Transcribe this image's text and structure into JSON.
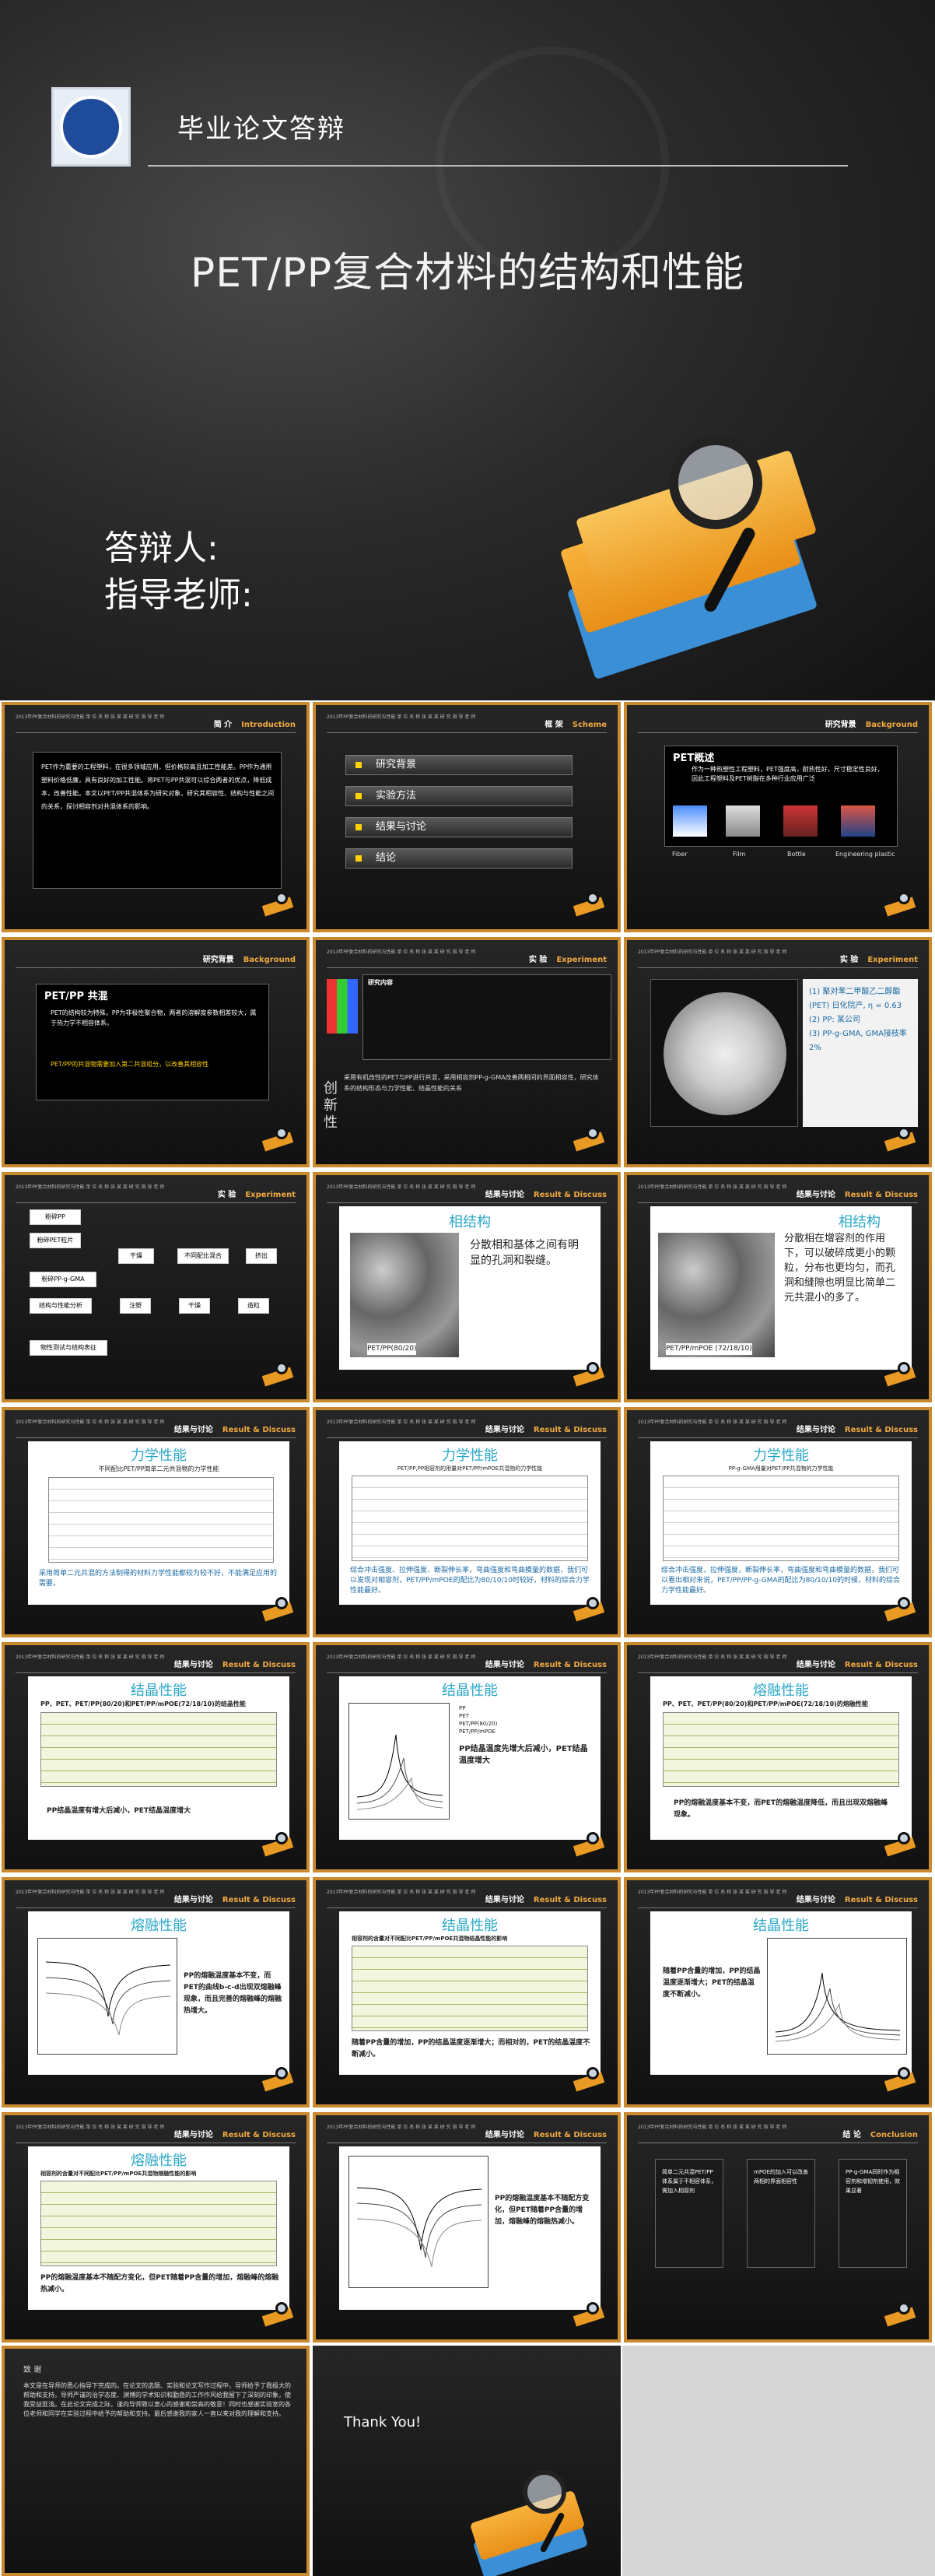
{
  "title_slide": {
    "school": "毕业论文答辩",
    "title": "PET/PP复合材料的结构和性能",
    "defender": "答辩人:",
    "advisor": "指导老师:"
  },
  "slide_header_tiny": "2013年PP复合材料的研究与性能\n单 位 名 称 张 某 某\n研 究 指 导 老 师",
  "slides": [
    {
      "cn": "简 介",
      "en": "Introduction",
      "body": "PET作为重要的工程塑料，在很多领域应用，但价格较高且加工性能差。PP作为通用塑料价格低廉，具有良好的加工性能。将PET与PP共混可以综合两者的优点，降低成本，改善性能。本文以PET/PP共混体系为研究对象，研究其相容性、结构与性能之间的关系，探讨相容剂对共混体系的影响。"
    },
    {
      "cn": "框 架",
      "en": "Scheme",
      "items": [
        "研究背景",
        "实验方法",
        "结果与讨论",
        "结论"
      ]
    },
    {
      "cn": "研究背景",
      "en": "Background",
      "head": "PET概述",
      "body": "作为一种热塑性工程塑料，PET强度高，耐热性好，尺寸稳定性良好，因此工程塑料及PET树脂在多种行业应用广泛",
      "labels": [
        "Fiber",
        "Film",
        "Bottle",
        "Engineering plastic"
      ]
    },
    {
      "cn": "研究背景",
      "en": "Background",
      "head": "PET/PP 共混",
      "body": "PET的结构较为特殊，PP为非极性聚合物，两者的溶解度参数相差较大，属于热力学不相容体系。",
      "highlight": "PET/PP的共混物需要加入第二共混组分，以改善其相容性"
    },
    {
      "cn": "实 验",
      "en": "Experiment",
      "head": "研究内容",
      "side": "创新性",
      "body": "采用有机改性的PET与PP进行共混，采用相容剂PP-g-GMA改善两相间的界面相容性，研究体系的结构形态与力学性能、结晶性能的关系"
    },
    {
      "cn": "实 验",
      "en": "Experiment",
      "body": "(1) 聚对苯二甲酸乙二醇酯(PET) 日化院产, η = 0.63\n(2) PP: 某公司\n(3) PP-g-GMA, GMA接枝率2%"
    },
    {
      "cn": "实 验",
      "en": "Experiment",
      "flow": [
        "粉碎PP",
        "粉碎PET粒片",
        "干燥",
        "粉碎PP-g-GMA",
        "不同配比混合",
        "挤出",
        "造粒",
        "干燥",
        "注塑",
        "结构与性能分析",
        "物性测试与结构表征"
      ]
    },
    {
      "cn": "结果与讨论",
      "en": "Result & Discuss",
      "title": "相结构",
      "body": "分散相和基体之间有明显的孔洞和裂缝。",
      "caption": "PET/PP(80/20)"
    },
    {
      "cn": "结果与讨论",
      "en": "Result & Discuss",
      "title": "相结构",
      "body": "分散相在增容剂的作用下，可以破碎成更小的颗粒，分布也更均匀，而孔洞和缝隙也明显比简单二元共混小的多了。",
      "caption": "PET/PP/mPOE (72/18/10)"
    },
    {
      "cn": "结果与讨论",
      "en": "Result & Discuss",
      "title": "力学性能",
      "subtitle": "不同配比PET/PP简单二元共混物的力学性能",
      "body": "采用简单二元共混的方法制得的材料力学性能都较为较不好，不能满足应用的需要。"
    },
    {
      "cn": "结果与讨论",
      "en": "Result & Discuss",
      "title": "力学性能",
      "subtitle": "PET/PP,PP相容剂的用量对PET/PP/mPOE共混物的力学性能",
      "body": "综合冲击强度、拉伸强度、断裂伸长率，弯曲强度和弯曲模量的数据，我们可以发现对相容剂，PET/PP/mPOE的配比为80/10/10时较好，材料的综合力学性能最好。"
    },
    {
      "cn": "结果与讨论",
      "en": "Result & Discuss",
      "title": "力学性能",
      "subtitle": "PP-g-GMA用量对PET/PP共混物的力学性能",
      "body": "综合冲击强度，拉伸强度，断裂伸长率，弯曲强度和弯曲模量的数据，我们可以看出相对来说，PET/PP/PP-g-GMA的配比为80/10/10的时候，材料的综合力学性能最好。"
    },
    {
      "cn": "结果与讨论",
      "en": "Result & Discuss",
      "title": "结晶性能",
      "subtitle": "PP、PET、PET/PP(80/20)和PET/PP/mPOE(72/18/10)的结晶性能",
      "body": "PP结晶温度有增大后减小，PET结晶温度增大"
    },
    {
      "cn": "结果与讨论",
      "en": "Result & Discuss",
      "title": "结晶性能",
      "body": "PP结晶温度先增大后减小，PET结晶温度增大",
      "legend": [
        "PP",
        "PET",
        "PET/PP(80/20)",
        "PET/PP/mPOE"
      ]
    },
    {
      "cn": "结果与讨论",
      "en": "Result & Discuss",
      "title": "熔融性能",
      "subtitle": "PP、PET、PET/PP(80/20)和PET/PP/mPOE(72/18/10)的熔融性能",
      "body": "PP的熔融温度基本不变，而PET的熔融温度降低，而且出现双熔融峰现象。"
    },
    {
      "cn": "结果与讨论",
      "en": "Result & Discuss",
      "title": "熔融性能",
      "body": "PP的熔融温度基本不变，而PET的曲线b-c-d出现双熔融峰现象，而且完善的熔融峰的熔融热增大。"
    },
    {
      "cn": "结果与讨论",
      "en": "Result & Discuss",
      "title": "结晶性能",
      "subtitle": "相容剂的含量对不同配比PET/PP/mPOE共混物结晶性能的影响",
      "body": "随着PP含量的增加，PP的结晶温度逐渐增大；而相对的，PET的结晶温度不断减小。"
    },
    {
      "cn": "结果与讨论",
      "en": "Result & Discuss",
      "title": "结晶性能",
      "body": "随着PP含量的增加，PP的结晶温度逐渐增大；PET的结晶温度不断减小。"
    },
    {
      "cn": "结果与讨论",
      "en": "Result & Discuss",
      "title": "熔融性能",
      "subtitle": "相容剂的含量对不同配比PET/PP/mPOE共混物熔融性能的影响",
      "body": "PP的熔融温度基本不随配方变化，但PET随着PP含量的增加，熔融峰的熔融热减小。"
    },
    {
      "cn": "结果与讨论",
      "en": "Result & Discuss",
      "body": "PP的熔融温度基本不随配方变化，但PET随着PP含量的增加，熔融峰的熔融热减小。"
    },
    {
      "cn": "结 论",
      "en": "Conclusion",
      "cards": [
        "简单二元共混PET/PP体系属于不相容体系，需加入相容剂",
        "mPOE的加入可以改善两相的界面相容性",
        "PP-g-GMA同时作为相容剂和增韧剂使用，效果显著"
      ]
    }
  ],
  "bottom": {
    "abstract_title": "致 谢",
    "abstract_body": "本文是在导师的悉心指导下完成的。在论文的选题、实验和论文写作过程中，导师给予了我极大的帮助和支持。导师严谨的治学态度、渊博的学术知识和勤恳的工作作风给我留下了深刻的印象，使我受益匪浅。在此论文完成之际，谨向导师致以衷心的感谢和崇高的敬意！同时也感谢实验室的各位老师和同学在实验过程中给予的帮助和支持。最后感谢我的家人一直以来对我的理解和支持。",
    "thanks": "Thank You!"
  }
}
